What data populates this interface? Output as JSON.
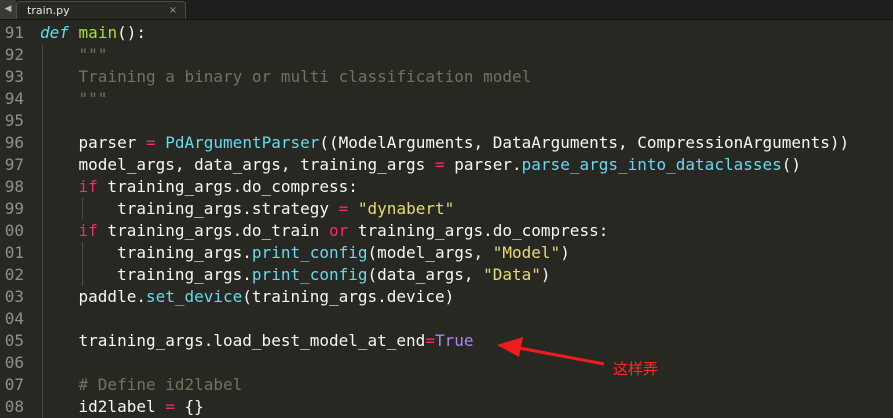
{
  "tab": {
    "title": "train.py",
    "close": "×",
    "scroll_arrow": "◀"
  },
  "code_lines": [
    {
      "num": "91",
      "tokens": [
        [
          "def",
          "def"
        ],
        [
          " ",
          ""
        ],
        [
          "main",
          "fn"
        ],
        [
          "():",
          ""
        ]
      ]
    },
    {
      "num": "92",
      "tokens": [
        [
          "    ",
          ""
        ],
        [
          "\"\"\"",
          "com"
        ]
      ]
    },
    {
      "num": "93",
      "tokens": [
        [
          "    ",
          ""
        ],
        [
          "Training a binary or multi classification model",
          "com"
        ]
      ]
    },
    {
      "num": "94",
      "tokens": [
        [
          "    ",
          ""
        ],
        [
          "\"\"\"",
          "com"
        ]
      ]
    },
    {
      "num": "95",
      "tokens": []
    },
    {
      "num": "96",
      "tokens": [
        [
          "    parser ",
          ""
        ],
        [
          "=",
          "kw"
        ],
        [
          " ",
          ""
        ],
        [
          "PdArgumentParser",
          "call"
        ],
        [
          "((ModelArguments, DataArguments, CompressionArguments))",
          ""
        ]
      ]
    },
    {
      "num": "97",
      "tokens": [
        [
          "    model_args, data_args, training_args ",
          ""
        ],
        [
          "=",
          "kw"
        ],
        [
          " parser.",
          ""
        ],
        [
          "parse_args_into_dataclasses",
          "call"
        ],
        [
          "()",
          ""
        ]
      ]
    },
    {
      "num": "98",
      "tokens": [
        [
          "    ",
          ""
        ],
        [
          "if",
          "kw"
        ],
        [
          " training_args.do_compress:",
          ""
        ]
      ]
    },
    {
      "num": "99",
      "tokens": [
        [
          "        training_args.strategy ",
          ""
        ],
        [
          "=",
          "kw"
        ],
        [
          " ",
          ""
        ],
        [
          "\"dynabert\"",
          "str"
        ]
      ]
    },
    {
      "num": "00",
      "tokens": [
        [
          "    ",
          ""
        ],
        [
          "if",
          "kw"
        ],
        [
          " training_args.do_train ",
          ""
        ],
        [
          "or",
          "kw"
        ],
        [
          " training_args.do_compress:",
          ""
        ]
      ]
    },
    {
      "num": "01",
      "tokens": [
        [
          "        training_args.",
          ""
        ],
        [
          "print_config",
          "call"
        ],
        [
          "(model_args, ",
          ""
        ],
        [
          "\"Model\"",
          "str"
        ],
        [
          ")",
          ""
        ]
      ]
    },
    {
      "num": "02",
      "tokens": [
        [
          "        training_args.",
          ""
        ],
        [
          "print_config",
          "call"
        ],
        [
          "(data_args, ",
          ""
        ],
        [
          "\"Data\"",
          "str"
        ],
        [
          ")",
          ""
        ]
      ]
    },
    {
      "num": "03",
      "tokens": [
        [
          "    paddle.",
          ""
        ],
        [
          "set_device",
          "call"
        ],
        [
          "(training_args.device)",
          ""
        ]
      ]
    },
    {
      "num": "04",
      "tokens": []
    },
    {
      "num": "05",
      "tokens": [
        [
          "    training_args.load_best_model_at_end",
          ""
        ],
        [
          "=",
          "kw"
        ],
        [
          "True",
          "const"
        ]
      ]
    },
    {
      "num": "06",
      "tokens": []
    },
    {
      "num": "07",
      "tokens": [
        [
          "    ",
          ""
        ],
        [
          "# Define id2label",
          "com"
        ]
      ]
    },
    {
      "num": "08",
      "tokens": [
        [
          "    id2label ",
          ""
        ],
        [
          "=",
          "kw"
        ],
        [
          " {}",
          ""
        ]
      ]
    }
  ],
  "annotation": {
    "text": "这样弄",
    "color": "#ff2a2a"
  },
  "colors": {
    "background": "#272822",
    "keyword": "#f92672",
    "function": "#a6e22e",
    "call": "#66d9ef",
    "string": "#e6db74",
    "comment": "#75715e",
    "constant": "#ae81ff"
  }
}
